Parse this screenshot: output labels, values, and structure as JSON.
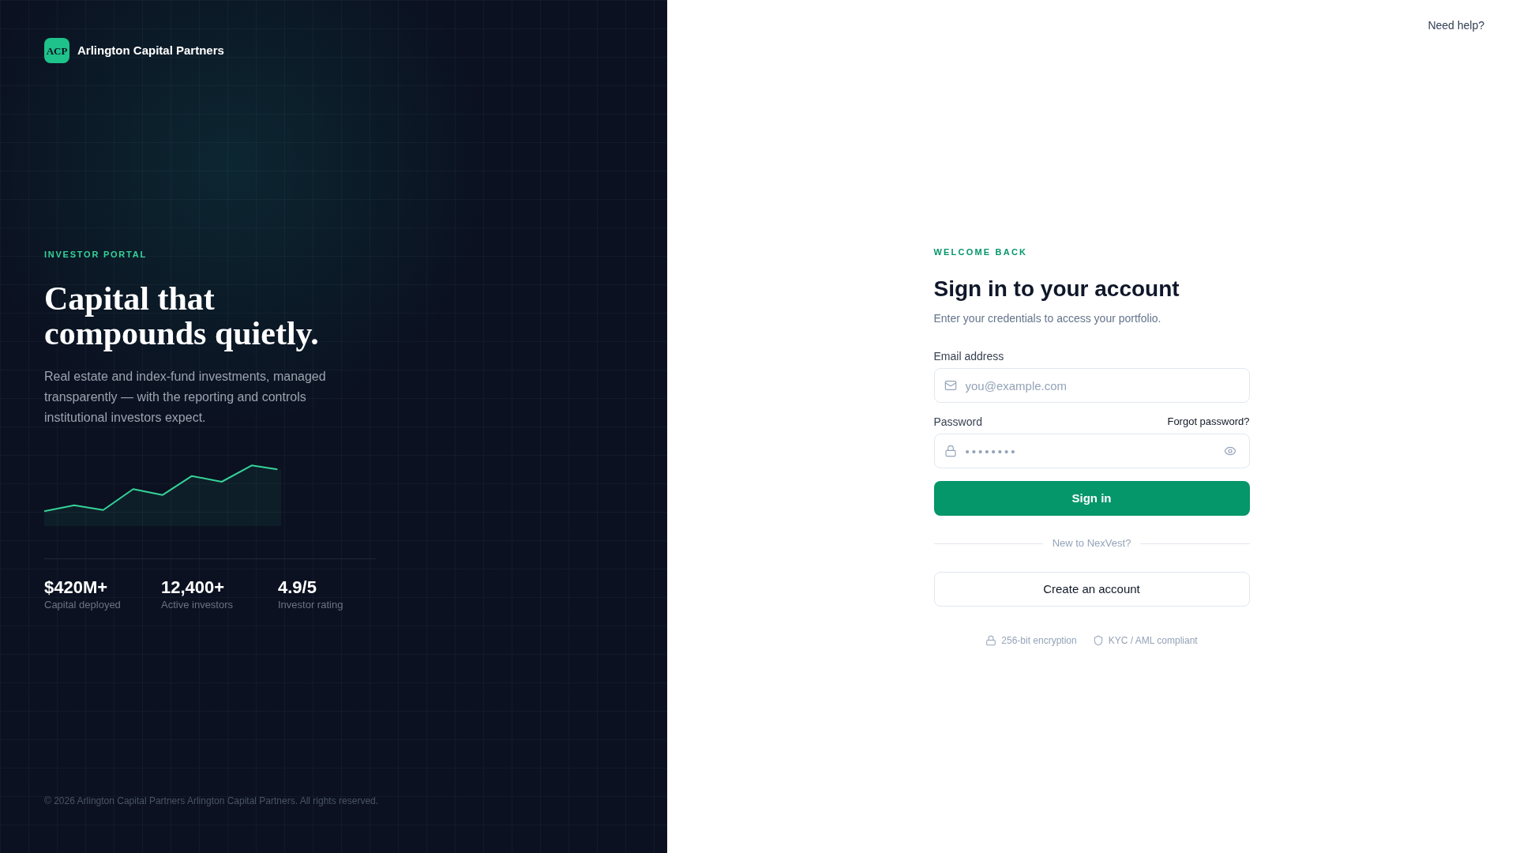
{
  "brand": {
    "logo_text": "ACP",
    "name": "Arlington Capital Partners"
  },
  "hero": {
    "eyebrow": "INVESTOR PORTAL",
    "headline": "Capital that compounds quietly.",
    "description": "Real estate and index-fund investments, managed transparently — with the reporting and controls institutional investors expect."
  },
  "stats": [
    {
      "value": "$420M+",
      "label": "Capital deployed"
    },
    {
      "value": "12,400+",
      "label": "Active investors"
    },
    {
      "value": "4.9/5",
      "label": "Investor rating"
    }
  ],
  "footer": {
    "copyright": "© 2026 Arlington Capital Partners Arlington Capital Partners. All rights reserved."
  },
  "header": {
    "help_link": "Need help?"
  },
  "form": {
    "eyebrow": "WELCOME BACK",
    "title": "Sign in to your account",
    "subtitle": "Enter your credentials to access your portfolio.",
    "fields": [
      {
        "kind": "email",
        "label": "Email address",
        "placeholder": "you@example.com"
      },
      {
        "kind": "password",
        "label": "Password",
        "link": "Forgot password?",
        "placeholder": "••••••••"
      }
    ],
    "submit": "Sign in",
    "divider": "New to NexVest?",
    "secondary_button": "Create an account",
    "trust_badges": [
      {
        "kind": "lock",
        "text": "256-bit encryption"
      },
      {
        "kind": "shield",
        "text": "KYC / AML compliant"
      }
    ]
  }
}
